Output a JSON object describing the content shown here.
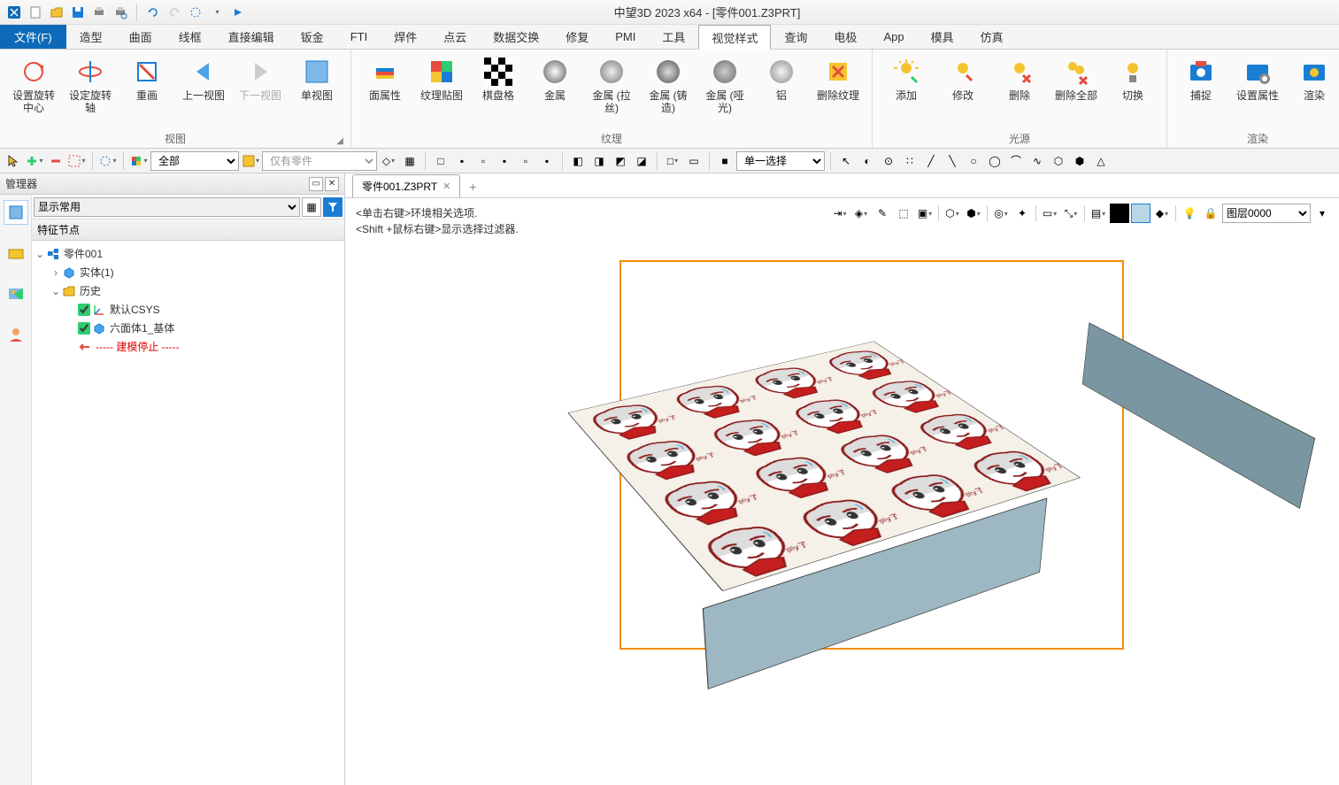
{
  "title": "中望3D 2023 x64 - [零件001.Z3PRT]",
  "menu": {
    "file": "文件(F)",
    "tabs": [
      "造型",
      "曲面",
      "线框",
      "直接编辑",
      "钣金",
      "FTI",
      "焊件",
      "点云",
      "数据交换",
      "修复",
      "PMI",
      "工具",
      "视觉样式",
      "查询",
      "电极",
      "App",
      "模具",
      "仿真"
    ],
    "active": "视觉样式"
  },
  "ribbon": {
    "groups": [
      {
        "name": "视图",
        "buttons": [
          {
            "id": "set-rotate-center",
            "label": "设置旋转中心"
          },
          {
            "id": "set-rotate-axis",
            "label": "设定旋转轴"
          },
          {
            "id": "repaint",
            "label": "重画"
          },
          {
            "id": "prev-view",
            "label": "上一视图"
          },
          {
            "id": "next-view",
            "label": "下一视图",
            "disabled": true
          },
          {
            "id": "single-view",
            "label": "单视图"
          }
        ]
      },
      {
        "name": "纹理",
        "buttons": [
          {
            "id": "face-attr",
            "label": "面属性"
          },
          {
            "id": "texture-map",
            "label": "纹理贴图"
          },
          {
            "id": "checker",
            "label": "棋盘格"
          },
          {
            "id": "metal",
            "label": "金属"
          },
          {
            "id": "metal-wire",
            "label": "金属 (拉丝)"
          },
          {
            "id": "metal-cast",
            "label": "金属 (铸造)"
          },
          {
            "id": "metal-matte",
            "label": "金属 (哑光)"
          },
          {
            "id": "aluminum",
            "label": "铝"
          },
          {
            "id": "delete-texture",
            "label": "删除纹理"
          }
        ]
      },
      {
        "name": "光源",
        "buttons": [
          {
            "id": "light-add",
            "label": "添加"
          },
          {
            "id": "light-modify",
            "label": "修改"
          },
          {
            "id": "light-delete",
            "label": "删除"
          },
          {
            "id": "light-delete-all",
            "label": "删除全部"
          },
          {
            "id": "light-switch",
            "label": "切换"
          }
        ]
      },
      {
        "name": "渲染",
        "buttons": [
          {
            "id": "capture",
            "label": "捕捉"
          },
          {
            "id": "render-attr",
            "label": "设置属性"
          },
          {
            "id": "render",
            "label": "渲染"
          }
        ]
      }
    ]
  },
  "toolbar2": {
    "filter_all": "全部",
    "only_parts": "仅有零件",
    "select_mode": "单一选择"
  },
  "manager": {
    "title": "管理器",
    "display_option": "显示常用",
    "tree_header": "特征节点",
    "tree": {
      "root": "零件001",
      "solid": "实体(1)",
      "history": "历史",
      "csys": "默认CSYS",
      "hex": "六面体1_基体",
      "stop": "----- 建模停止 -----"
    }
  },
  "doc_tab": "零件001.Z3PRT",
  "hints": {
    "line1": "<单击右键>环境相关选项.",
    "line2": "<Shift +鼠标右键>显示选择过滤器."
  },
  "layer": "图层0000"
}
